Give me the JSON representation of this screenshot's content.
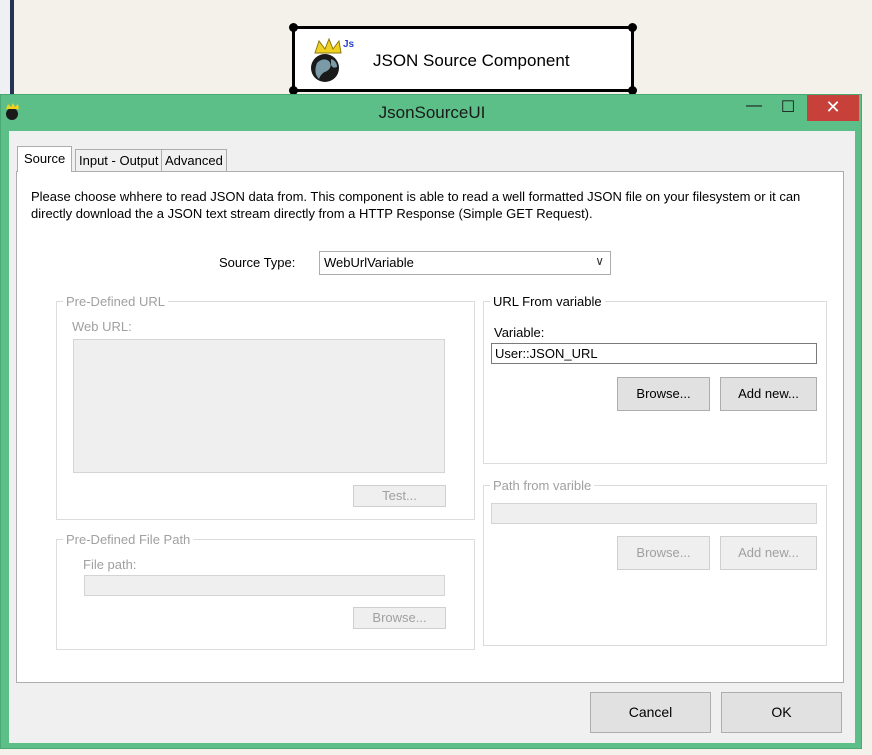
{
  "designer": {
    "component_title": "JSON Source Component",
    "component_icon": "json-globe-crown-icon"
  },
  "window": {
    "title": "JsonSourceUI",
    "app_icon": "json-globe-crown-icon",
    "minimize_glyph": "—",
    "maximize_glyph": "☐",
    "close_glyph": "✕",
    "accent_color": "#5cbf88",
    "close_color": "#c7403a"
  },
  "tabs": [
    {
      "label": "Source",
      "active": true
    },
    {
      "label": "Input - Output",
      "active": false
    },
    {
      "label": "Advanced",
      "active": false
    }
  ],
  "source_tab": {
    "intro": "Please choose whhere to read JSON data from. This component is able to read a well formatted JSON file on your filesystem or it can directly download the a JSON text stream directly from a HTTP Response (Simple GET Request).",
    "source_type_label": "Source Type:",
    "source_type_value": "WebUrlVariable",
    "predefined_url": {
      "legend": "Pre-Defined URL",
      "web_url_label": "Web URL:",
      "web_url_value": "",
      "test_button": "Test..."
    },
    "predefined_file": {
      "legend": "Pre-Defined File Path",
      "file_path_label": "File path:",
      "file_path_value": "",
      "browse_button": "Browse..."
    },
    "url_from_variable": {
      "legend": "URL From variable",
      "variable_label": "Variable:",
      "variable_value": "User::JSON_URL",
      "browse_button": "Browse...",
      "add_new_button": "Add new..."
    },
    "path_from_variable": {
      "legend": "Path from varible",
      "value": "",
      "browse_button": "Browse...",
      "add_new_button": "Add new..."
    }
  },
  "footer": {
    "cancel_button": "Cancel",
    "ok_button": "OK"
  }
}
